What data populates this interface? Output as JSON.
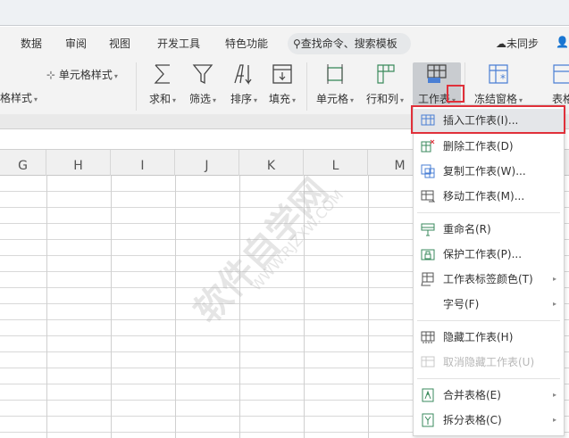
{
  "tabs": [
    "数据",
    "审阅",
    "视图",
    "开发工具",
    "特色功能"
  ],
  "search": {
    "placeholder": "查找命令、搜索模板"
  },
  "sync": {
    "label": "未同步"
  },
  "ribbon": {
    "cell_style": "单元格样式",
    "table_style": "格样式",
    "tools": [
      "求和",
      "筛选",
      "排序",
      "填充",
      "单元格",
      "行和列",
      "工作表",
      "冻结窗格",
      "表格"
    ]
  },
  "columns": [
    "G",
    "H",
    "I",
    "J",
    "K",
    "L",
    "M"
  ],
  "menu": {
    "items": [
      {
        "label": "插入工作表(I)...",
        "icon": "insert-sheet-icon"
      },
      {
        "label": "删除工作表(D)",
        "icon": "delete-sheet-icon"
      },
      {
        "label": "复制工作表(W)...",
        "icon": "copy-sheet-icon"
      },
      {
        "label": "移动工作表(M)...",
        "icon": "move-sheet-icon"
      },
      {
        "label": "重命名(R)",
        "icon": "rename-icon"
      },
      {
        "label": "保护工作表(P)...",
        "icon": "protect-sheet-icon"
      },
      {
        "label": "工作表标签颜色(T)",
        "icon": "tab-color-icon"
      },
      {
        "label": "字号(F)",
        "icon": ""
      },
      {
        "label": "隐藏工作表(H)",
        "icon": "hide-sheet-icon"
      },
      {
        "label": "取消隐藏工作表(U)",
        "icon": "unhide-sheet-icon"
      },
      {
        "label": "合并表格(E)",
        "icon": "merge-table-icon"
      },
      {
        "label": "拆分表格(C)",
        "icon": "split-table-icon"
      }
    ]
  },
  "watermark": {
    "text": "软件自学网",
    "url": "WWW.RJZXW.COM"
  },
  "colors": {
    "highlight": "#e0303a",
    "accent": "#4a7fd4"
  }
}
